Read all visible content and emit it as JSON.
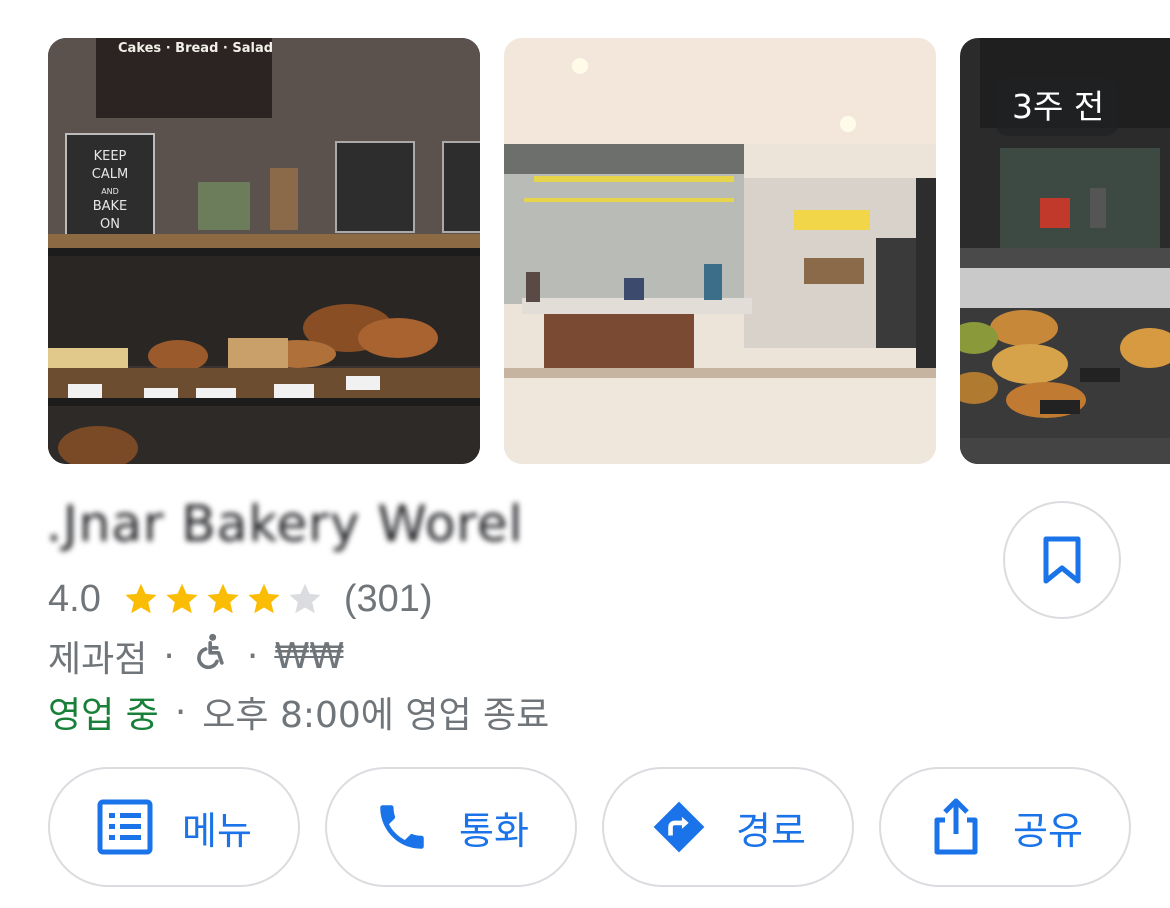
{
  "photos": [
    {
      "name": "bakery-shelf-photo",
      "poster_text": "KEEP CALM AND BAKE ON",
      "sign_text": "Cakes · Bread · Salad"
    },
    {
      "name": "cafe-interior-photo"
    },
    {
      "name": "pastry-counter-photo",
      "age_badge": "3주 전"
    }
  ],
  "place": {
    "name": ".Jnar Bakery Worel",
    "rating": "4.0",
    "stars_filled": 4,
    "stars_total": 5,
    "review_count": "(301)",
    "category": "제과점",
    "dot": "·",
    "price_level": "₩₩",
    "status": "영업 중",
    "hours": "오후 8:00에 영업 종료"
  },
  "actions": [
    {
      "label": "메뉴",
      "icon": "menu-list-icon"
    },
    {
      "label": "통화",
      "icon": "phone-icon"
    },
    {
      "label": "경로",
      "icon": "directions-icon"
    },
    {
      "label": "공유",
      "icon": "share-icon"
    }
  ],
  "colors": {
    "accent": "#1a73e8",
    "open_green": "#188038",
    "star_yellow": "#fbbc04",
    "star_empty": "#dadce0",
    "text_secondary": "#70757a",
    "border": "#dadce0"
  }
}
